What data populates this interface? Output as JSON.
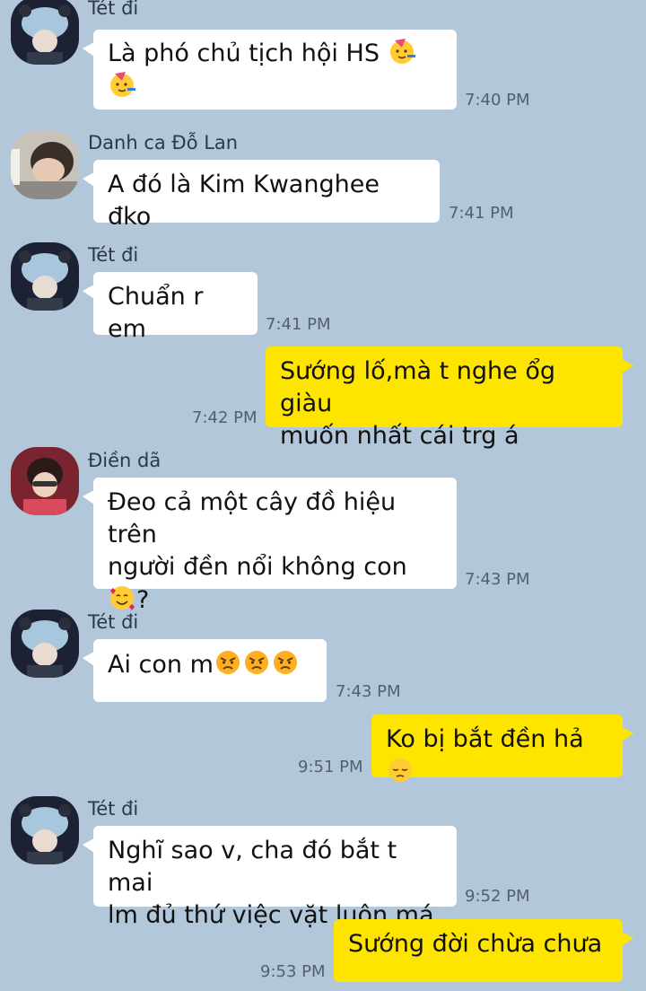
{
  "colors": {
    "background": "#b2c7d9",
    "incoming_bubble": "#ffffff",
    "outgoing_bubble": "#fee500",
    "time_text": "#55606b"
  },
  "messages": [
    {
      "sender": "Tét đi",
      "text": "Là phó chủ tịch hội HS",
      "emoji": "partying-face-icon",
      "time": "7:40 PM",
      "outgoing": false
    },
    {
      "sender": "Danh ca Đỗ Lan",
      "text": "A đó là Kim Kwanghee đko",
      "time": "7:41 PM",
      "outgoing": false
    },
    {
      "sender": "Tét đi",
      "text": "Chuẩn r em",
      "time": "7:41 PM",
      "outgoing": false
    },
    {
      "line1": "Sướng lố,mà t nghe ổg giàu",
      "line2": "muốn nhất cái trg á",
      "time": "7:42 PM",
      "outgoing": true
    },
    {
      "sender": "Điền dã",
      "line1": "Đeo cả một cây đồ hiệu trên",
      "line2": "người đền nổi không con",
      "suffix": "?",
      "emoji": "smiling-face-with-hearts-icon",
      "time": "7:43 PM",
      "outgoing": false
    },
    {
      "sender": "Tét đi",
      "text": "Ai con m",
      "emoji": "angry-face-icon",
      "time": "7:43 PM",
      "outgoing": false
    },
    {
      "text": "Ko bị bắt đền hả",
      "emoji": "pensive-face-icon",
      "time": "9:51 PM",
      "outgoing": true
    },
    {
      "sender": "Tét đi",
      "line1": "Nghĩ sao v, cha đó bắt t mai",
      "line2": "lm đủ thứ việc vặt luôn má",
      "time": "9:52 PM",
      "outgoing": false
    },
    {
      "text": "Sướng đời chừa chưa",
      "time": "9:53 PM",
      "outgoing": true
    }
  ]
}
